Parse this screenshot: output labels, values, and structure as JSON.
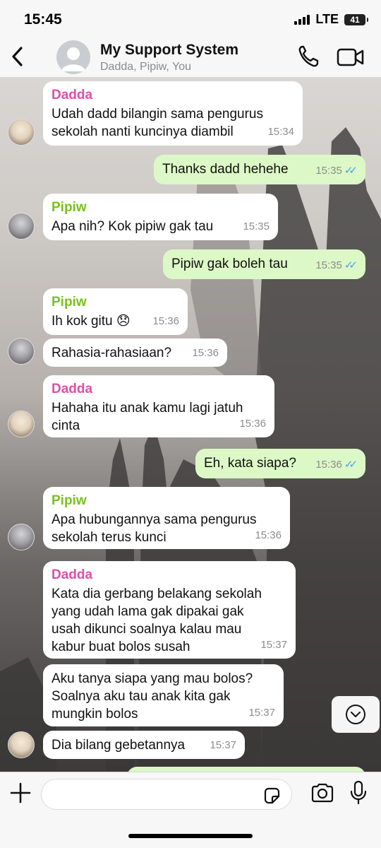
{
  "status": {
    "time": "15:45",
    "network": "LTE",
    "battery": "41"
  },
  "header": {
    "title": "My Support System",
    "subtitle": "Dadda, Pipiw, You"
  },
  "messages": [
    {
      "sender": "Dadda",
      "text": "Udah dadd bilangin sama pengurus\nsekolah nanti kuncinya diambil",
      "time": "15:34"
    },
    {
      "sender": "",
      "text": "Thanks dadd hehehe",
      "time": "15:35",
      "outgoing": true
    },
    {
      "sender": "Pipiw",
      "text": "Apa nih? Kok pipiw gak tau",
      "time": "15:35"
    },
    {
      "sender": "",
      "text": "Pipiw gak boleh tau",
      "time": "15:35",
      "outgoing": true
    },
    {
      "sender": "Pipiw",
      "text": "Ih kok gitu 😞",
      "time": "15:36"
    },
    {
      "sender": "",
      "text": "Rahasia-rahasiaan?",
      "time": "15:36"
    },
    {
      "sender": "Dadda",
      "text": "Hahaha itu anak kamu lagi jatuh\ncinta",
      "time": "15:36"
    },
    {
      "sender": "",
      "text": "Eh, kata siapa?",
      "time": "15:36",
      "outgoing": true
    },
    {
      "sender": "Pipiw",
      "text": "Apa hubungannya sama pengurus\nsekolah terus kunci",
      "time": "15:36"
    },
    {
      "sender": "Dadda",
      "text": "Kata dia gerbang belakang sekolah\nyang udah lama gak dipakai gak\nusah dikunci soalnya kalau mau\nkabur buat bolos susah",
      "time": "15:37"
    },
    {
      "sender": "",
      "text": "Aku tanya siapa yang mau bolos?\nSoalnya aku tau anak kita gak\nmungkin bolos",
      "time": "15:37"
    },
    {
      "sender": "",
      "text": "Dia bilang gebetannya",
      "time": "15:37"
    }
  ],
  "icons": {
    "back": "chevron-left-icon",
    "group_avatar": "group-avatar-icon",
    "call": "phone-icon",
    "video": "video-camera-icon",
    "scroll": "chevron-down-icon",
    "attach": "plus-icon",
    "sticker": "sticker-icon",
    "camera": "camera-icon",
    "mic": "microphone-icon"
  },
  "colors": {
    "incoming": "#ffffff",
    "outgoing": "#dcf8c6",
    "dadda": "#e14da7",
    "pipiw": "#78c21e",
    "read_ticks": "#4aa3e6"
  }
}
